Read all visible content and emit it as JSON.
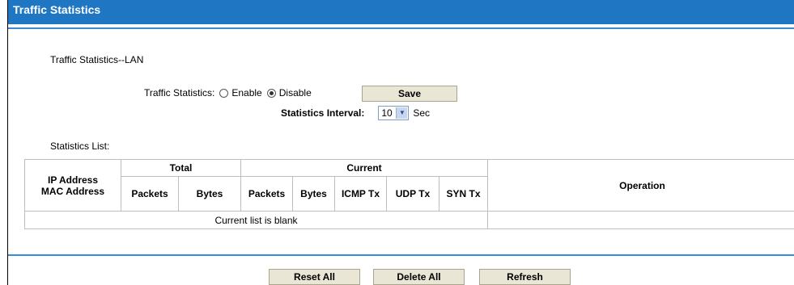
{
  "header": {
    "title": "Traffic Statistics"
  },
  "section": {
    "title": "Traffic Statistics--LAN"
  },
  "settings": {
    "traffic_label": "Traffic Statistics:",
    "enable_label": "Enable",
    "disable_label": "Disable",
    "selected": "Disable",
    "save_label": "Save",
    "interval_label": "Statistics Interval:",
    "interval_value": "10",
    "interval_unit": "Sec"
  },
  "list": {
    "label": "Statistics List:",
    "headers": {
      "ip_address": "IP Address",
      "mac_address": "MAC Address",
      "total": "Total",
      "current": "Current",
      "operation": "Operation",
      "total_packets": "Packets",
      "total_bytes": "Bytes",
      "current_packets": "Packets",
      "current_bytes": "Bytes",
      "icmp_tx": "ICMP Tx",
      "udp_tx": "UDP Tx",
      "syn_tx": "SYN Tx"
    },
    "empty_message": "Current list is blank"
  },
  "footer": {
    "reset_all": "Reset All",
    "delete_all": "Delete All",
    "refresh": "Refresh"
  },
  "colors": {
    "header_bg": "#1f77c4",
    "stripe": "#3a8ad6",
    "button_bg": "#e9e6d6"
  }
}
